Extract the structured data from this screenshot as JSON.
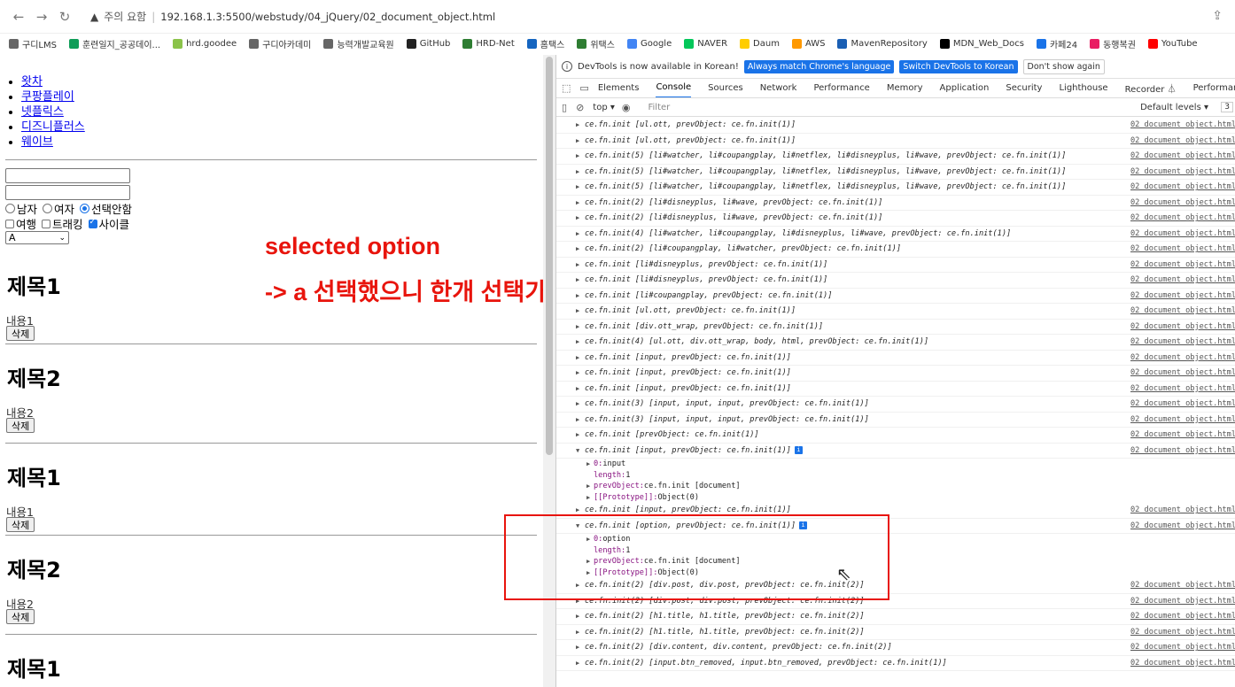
{
  "browser": {
    "warning_label": "주의 요함",
    "url": "192.168.1.3:5500/webstudy/04_jQuery/02_document_object.html",
    "bookmarks": [
      {
        "label": "구디LMS",
        "color": "#666"
      },
      {
        "label": "훈련일지_공공데이...",
        "color": "#0f9d58"
      },
      {
        "label": "hrd.goodee",
        "color": "#8bc34a"
      },
      {
        "label": "구디아카데미",
        "color": "#666"
      },
      {
        "label": "능력개발교육원",
        "color": "#666"
      },
      {
        "label": "GitHub",
        "color": "#222"
      },
      {
        "label": "HRD-Net",
        "color": "#2e7d32"
      },
      {
        "label": "홈택스",
        "color": "#1565c0"
      },
      {
        "label": "위택스",
        "color": "#2e7d32"
      },
      {
        "label": "Google",
        "color": "#4285f4"
      },
      {
        "label": "NAVER",
        "color": "#03c75a"
      },
      {
        "label": "Daum",
        "color": "#ffcd00"
      },
      {
        "label": "AWS",
        "color": "#ff9900"
      },
      {
        "label": "MavenRepository",
        "color": "#1a5fb4"
      },
      {
        "label": "MDN_Web_Docs",
        "color": "#000"
      },
      {
        "label": "카페24",
        "color": "#1a73e8"
      },
      {
        "label": "동행복권",
        "color": "#e91e63"
      },
      {
        "label": "YouTube",
        "color": "#ff0000"
      }
    ]
  },
  "page": {
    "ott_items": [
      "왓차",
      "쿠팡플레이",
      "넷플릭스",
      "디즈니플러스",
      "웨이브"
    ],
    "radios": [
      {
        "label": "남자",
        "checked": false
      },
      {
        "label": "여자",
        "checked": false
      },
      {
        "label": "선택안함",
        "checked": true
      }
    ],
    "checks": [
      {
        "label": "여행",
        "checked": false
      },
      {
        "label": "트래킹",
        "checked": false
      },
      {
        "label": "사이클",
        "checked": true
      }
    ],
    "select_value": "A",
    "posts": [
      {
        "title": "제목1",
        "content": "내용1",
        "button": "삭제"
      },
      {
        "title": "제목2",
        "content": "내용2",
        "button": "삭제"
      },
      {
        "title": "제목1",
        "content": "내용1",
        "button": "삭제"
      },
      {
        "title": "제목2",
        "content": "내용2",
        "button": "삭제"
      },
      {
        "title": "제목1"
      }
    ]
  },
  "annotation": {
    "line1": "selected option",
    "line2": "-> a 선택했으니 한개 선택가능"
  },
  "devtools": {
    "info_text": "DevTools is now available in Korean!",
    "btn_match": "Always match Chrome's language",
    "btn_switch": "Switch DevTools to Korean",
    "btn_dont": "Don't show again",
    "tabs": [
      "Elements",
      "Console",
      "Sources",
      "Network",
      "Performance",
      "Memory",
      "Application",
      "Security",
      "Lighthouse",
      "Recorder ⏃",
      "Performance insights"
    ],
    "context": "top ▾",
    "filter_placeholder": "Filter",
    "levels": "Default levels ▾",
    "count": "3",
    "source_label": "02_document_object.html"
  },
  "console_logs": [
    {
      "type": "log",
      "text": "ce.fn.init [ul.ott, prevObject: ce.fn.init(1)]"
    },
    {
      "type": "log",
      "text": "ce.fn.init [ul.ott, prevObject: ce.fn.init(1)]"
    },
    {
      "type": "log",
      "text": "ce.fn.init(5) [li#watcher, li#coupangplay, li#netflex, li#disneyplus, li#wave, prevObject: ce.fn.init(1)]"
    },
    {
      "type": "log",
      "text": "ce.fn.init(5) [li#watcher, li#coupangplay, li#netflex, li#disneyplus, li#wave, prevObject: ce.fn.init(1)]"
    },
    {
      "type": "log",
      "text": "ce.fn.init(5) [li#watcher, li#coupangplay, li#netflex, li#disneyplus, li#wave, prevObject: ce.fn.init(1)]"
    },
    {
      "type": "log",
      "text": "ce.fn.init(2) [li#disneyplus, li#wave, prevObject: ce.fn.init(1)]"
    },
    {
      "type": "log",
      "text": "ce.fn.init(2) [li#disneyplus, li#wave, prevObject: ce.fn.init(1)]"
    },
    {
      "type": "log",
      "text": "ce.fn.init(4) [li#watcher, li#coupangplay, li#disneyplus, li#wave, prevObject: ce.fn.init(1)]"
    },
    {
      "type": "log",
      "text": "ce.fn.init(2) [li#coupangplay, li#watcher, prevObject: ce.fn.init(1)]"
    },
    {
      "type": "log",
      "text": "ce.fn.init [li#disneyplus, prevObject: ce.fn.init(1)]"
    },
    {
      "type": "log",
      "text": "ce.fn.init [li#disneyplus, prevObject: ce.fn.init(1)]"
    },
    {
      "type": "log",
      "text": "ce.fn.init [li#coupangplay, prevObject: ce.fn.init(1)]"
    },
    {
      "type": "log",
      "text": "ce.fn.init [ul.ott, prevObject: ce.fn.init(1)]"
    },
    {
      "type": "log",
      "text": "ce.fn.init [div.ott_wrap, prevObject: ce.fn.init(1)]"
    },
    {
      "type": "log",
      "text": "ce.fn.init(4) [ul.ott, div.ott_wrap, body, html, prevObject: ce.fn.init(1)]"
    },
    {
      "type": "log",
      "text": "ce.fn.init [input, prevObject: ce.fn.init(1)]"
    },
    {
      "type": "log",
      "text": "ce.fn.init [input, prevObject: ce.fn.init(1)]"
    },
    {
      "type": "log",
      "text": "ce.fn.init [input, prevObject: ce.fn.init(1)]"
    },
    {
      "type": "log",
      "text": "ce.fn.init(3) [input, input, input, prevObject: ce.fn.init(1)]"
    },
    {
      "type": "log",
      "text": "ce.fn.init(3) [input, input, input, prevObject: ce.fn.init(1)]"
    },
    {
      "type": "log",
      "text": "ce.fn.init [prevObject: ce.fn.init(1)]"
    },
    {
      "type": "log",
      "expanded": true,
      "text": "ce.fn.init [input, prevObject: ce.fn.init(1)]"
    },
    {
      "type": "sub",
      "arrow": true,
      "key": "0: ",
      "val": "input"
    },
    {
      "type": "sub",
      "arrow": false,
      "key": "length: ",
      "val": "1"
    },
    {
      "type": "sub",
      "arrow": true,
      "key": "prevObject: ",
      "val": "ce.fn.init [document]"
    },
    {
      "type": "sub",
      "arrow": true,
      "key": "[[Prototype]]: ",
      "val": "Object(0)"
    },
    {
      "type": "log",
      "text": "ce.fn.init [input, prevObject: ce.fn.init(1)]"
    },
    {
      "type": "log",
      "expanded": true,
      "text": "ce.fn.init [option, prevObject: ce.fn.init(1)]"
    },
    {
      "type": "sub",
      "arrow": true,
      "key": "0: ",
      "val": "option"
    },
    {
      "type": "sub",
      "arrow": false,
      "key": "length: ",
      "val": "1"
    },
    {
      "type": "sub",
      "arrow": true,
      "key": "prevObject: ",
      "val": "ce.fn.init [document]"
    },
    {
      "type": "sub",
      "arrow": true,
      "key": "[[Prototype]]: ",
      "val": "Object(0)"
    },
    {
      "type": "log",
      "text": "ce.fn.init(2) [div.post, div.post, prevObject: ce.fn.init(2)]"
    },
    {
      "type": "log",
      "text": "ce.fn.init(2) [div.post, div.post, prevObject: ce.fn.init(2)]"
    },
    {
      "type": "log",
      "text": "ce.fn.init(2) [h1.title, h1.title, prevObject: ce.fn.init(2)]"
    },
    {
      "type": "log",
      "text": "ce.fn.init(2) [h1.title, h1.title, prevObject: ce.fn.init(2)]"
    },
    {
      "type": "log",
      "text": "ce.fn.init(2) [div.content, div.content, prevObject: ce.fn.init(2)]"
    },
    {
      "type": "log",
      "text": "ce.fn.init(2) [input.btn_removed, input.btn_removed, prevObject: ce.fn.init(1)]"
    }
  ]
}
